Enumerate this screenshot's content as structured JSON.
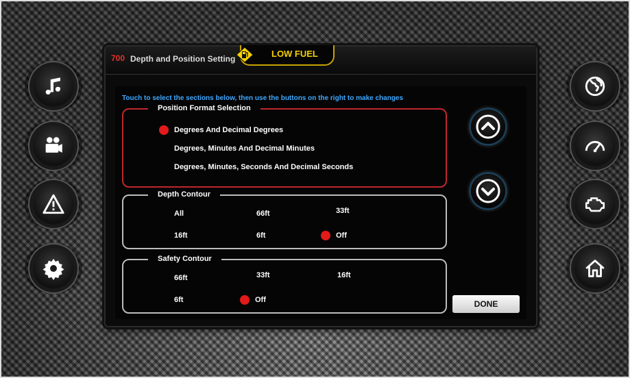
{
  "header": {
    "screen_number": "700",
    "title": "Depth and Position Setting",
    "fuel_warning": "LOW FUEL"
  },
  "instructions": "Touch to select the sections below, then use the buttons on the right to make changes",
  "position_format": {
    "title": "Position Format Selection",
    "options": [
      "Degrees And Decimal Degrees",
      "Degrees, Minutes And Decimal Minutes",
      "Degrees, Minutes, Seconds And Decimal Seconds"
    ],
    "selected": "Degrees And Decimal Degrees"
  },
  "depth_contour": {
    "title": "Depth Contour",
    "options": [
      "All",
      "66ft",
      "33ft",
      "16ft",
      "6ft",
      "Off"
    ],
    "selected": "Off"
  },
  "safety_contour": {
    "title": "Safety Contour",
    "options": [
      "66ft",
      "33ft",
      "16ft",
      "6ft",
      "Off"
    ],
    "selected": "Off"
  },
  "buttons": {
    "done": "DONE"
  },
  "left_buttons": [
    "music-icon",
    "video-camera-icon",
    "warning-icon",
    "gear-icon"
  ],
  "right_buttons": [
    "globe-icon",
    "speedometer-icon",
    "engine-icon",
    "home-icon"
  ],
  "colors": {
    "accent_blue": "#3fa8ff",
    "selected_red": "#e21a1a",
    "warning_yellow": "#f5d000",
    "active_border": "#c0272d"
  }
}
